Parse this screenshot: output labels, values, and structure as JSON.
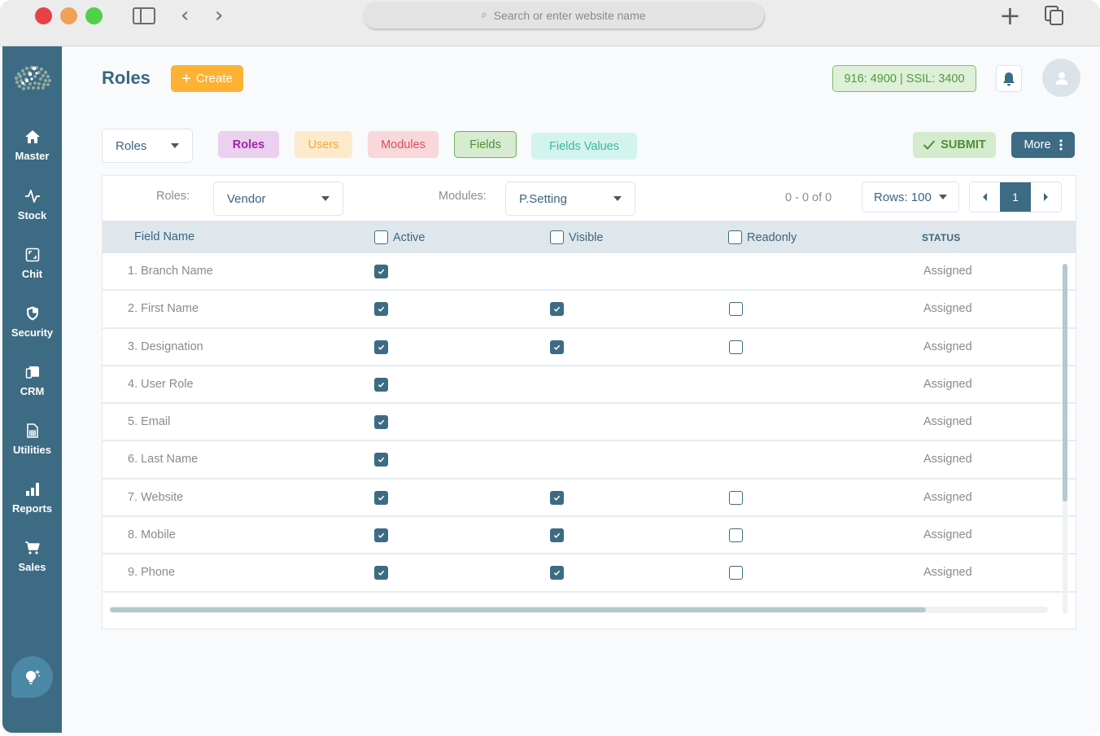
{
  "browser": {
    "url_placeholder": "Search or enter website name"
  },
  "sidebar": {
    "items": [
      {
        "label": "Master",
        "icon": "home-icon"
      },
      {
        "label": "Stock",
        "icon": "activity-icon"
      },
      {
        "label": "Chit",
        "icon": "expand-square-icon"
      },
      {
        "label": "Security",
        "icon": "shield-icon"
      },
      {
        "label": "CRM",
        "icon": "devices-icon"
      },
      {
        "label": "Utilities",
        "icon": "spreadsheet-icon"
      },
      {
        "label": "Reports",
        "icon": "bar-chart-icon"
      },
      {
        "label": "Sales",
        "icon": "cart-icon"
      }
    ],
    "assistant_icon": "lightbulb-sparkle-icon"
  },
  "header": {
    "title": "Roles",
    "create_label": "Create",
    "gold_rate": "916: 4900 | SSIL: 3400"
  },
  "filters": {
    "type_select": "Roles",
    "chips": [
      "Roles",
      "Users",
      "Modules",
      "Fields",
      "Fields Values"
    ],
    "active_chip": "Fields",
    "submit_label": "SUBMIT",
    "more_label": "More"
  },
  "table_controls": {
    "roles_label": "Roles:",
    "roles_value": "Vendor",
    "modules_label": "Modules:",
    "modules_value": "P.Setting",
    "range_text": "0 - 0 of 0",
    "rows_label": "Rows: 100",
    "current_page": "1"
  },
  "table": {
    "columns": [
      "Field Name",
      "Active",
      "Visible",
      "Readonly",
      "STATUS"
    ],
    "rows": [
      {
        "name": "1. Branch Name",
        "active": true,
        "visible": null,
        "readonly": null,
        "status": "Assigned"
      },
      {
        "name": "2. First Name",
        "active": true,
        "visible": true,
        "readonly": false,
        "status": "Assigned"
      },
      {
        "name": "3. Designation",
        "active": true,
        "visible": true,
        "readonly": false,
        "status": "Assigned"
      },
      {
        "name": "4. User Role",
        "active": true,
        "visible": null,
        "readonly": null,
        "status": "Assigned"
      },
      {
        "name": "5. Email",
        "active": true,
        "visible": null,
        "readonly": null,
        "status": "Assigned"
      },
      {
        "name": "6. Last Name",
        "active": true,
        "visible": null,
        "readonly": null,
        "status": "Assigned"
      },
      {
        "name": "7. Website",
        "active": true,
        "visible": true,
        "readonly": false,
        "status": "Assigned"
      },
      {
        "name": "8. Mobile",
        "active": true,
        "visible": true,
        "readonly": false,
        "status": "Assigned"
      },
      {
        "name": "9. Phone",
        "active": true,
        "visible": true,
        "readonly": false,
        "status": "Assigned"
      }
    ],
    "vertical_scroll_fraction_visible": 0.68,
    "horizontal_scroll_fraction_visible": 0.87
  },
  "colors": {
    "primary": "#3d6b84",
    "create": "#fdb234",
    "success": "#4d8f39"
  }
}
